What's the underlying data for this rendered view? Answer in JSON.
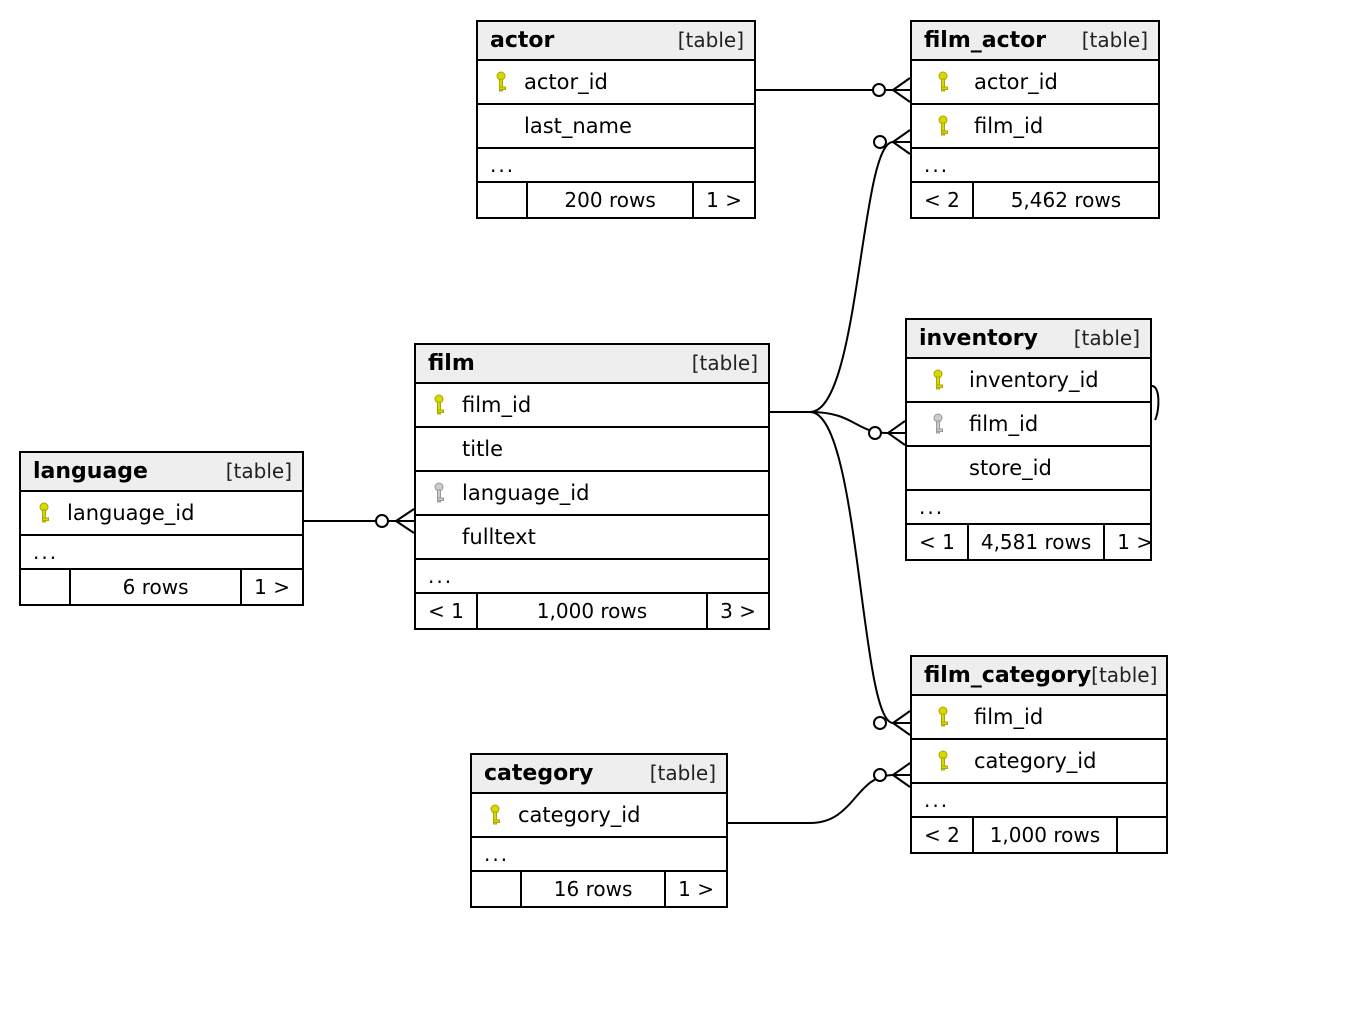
{
  "meta": {
    "type_label": "[table]",
    "ellipsis": "..."
  },
  "tables": {
    "actor": {
      "name": "actor",
      "columns": [
        {
          "name": "actor_id",
          "key": "pk"
        },
        {
          "name": "last_name",
          "key": null
        }
      ],
      "footer": {
        "in": "",
        "rows": "200 rows",
        "out": "1 >"
      }
    },
    "film_actor": {
      "name": "film_actor",
      "columns": [
        {
          "name": "actor_id",
          "key": "pk"
        },
        {
          "name": "film_id",
          "key": "pk"
        }
      ],
      "footer": {
        "in": "< 2",
        "rows": "5,462 rows",
        "out": ""
      }
    },
    "language": {
      "name": "language",
      "columns": [
        {
          "name": "language_id",
          "key": "pk"
        }
      ],
      "footer": {
        "in": "",
        "rows": "6 rows",
        "out": "1 >"
      }
    },
    "film": {
      "name": "film",
      "columns": [
        {
          "name": "film_id",
          "key": "pk"
        },
        {
          "name": "title",
          "key": null
        },
        {
          "name": "language_id",
          "key": "fk"
        },
        {
          "name": "fulltext",
          "key": null
        }
      ],
      "footer": {
        "in": "< 1",
        "rows": "1,000 rows",
        "out": "3 >"
      }
    },
    "inventory": {
      "name": "inventory",
      "columns": [
        {
          "name": "inventory_id",
          "key": "pk"
        },
        {
          "name": "film_id",
          "key": "fk"
        },
        {
          "name": "store_id",
          "key": null
        }
      ],
      "footer": {
        "in": "< 1",
        "rows": "4,581 rows",
        "out": "1 >"
      }
    },
    "category": {
      "name": "category",
      "columns": [
        {
          "name": "category_id",
          "key": "pk"
        }
      ],
      "footer": {
        "in": "",
        "rows": "16 rows",
        "out": "1 >"
      }
    },
    "film_category": {
      "name": "film_category",
      "columns": [
        {
          "name": "film_id",
          "key": "pk"
        },
        {
          "name": "category_id",
          "key": "pk"
        }
      ],
      "footer": {
        "in": "< 2",
        "rows": "1,000 rows",
        "out": ""
      }
    }
  },
  "relationships": [
    {
      "from": "actor.actor_id",
      "to": "film_actor.actor_id",
      "type": "one-to-many"
    },
    {
      "from": "film.film_id",
      "to": "film_actor.film_id",
      "type": "one-to-many"
    },
    {
      "from": "film.film_id",
      "to": "inventory.film_id",
      "type": "one-to-many"
    },
    {
      "from": "film.film_id",
      "to": "film_category.film_id",
      "type": "one-to-many"
    },
    {
      "from": "language.language_id",
      "to": "film.language_id",
      "type": "one-to-many"
    },
    {
      "from": "category.category_id",
      "to": "film_category.category_id",
      "type": "one-to-many"
    }
  ]
}
